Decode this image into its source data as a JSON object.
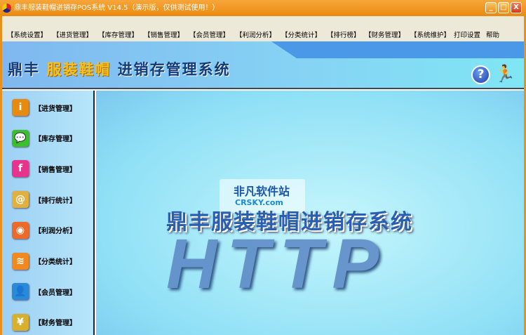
{
  "window": {
    "title": "鼎丰服装鞋帽进销存POS系统 V14.5（演示版，仅供测试使用！）",
    "minimize": "_",
    "maximize": "□",
    "close": "X"
  },
  "menu": [
    "【系统设置】",
    "【进货管理】",
    "【库存管理】",
    "【销售管理】",
    "【会员管理】",
    "【利润分析】",
    "【分类统计】",
    "【排行榜】",
    "【财务管理】",
    "【系统维护】",
    "打印设置",
    "帮助"
  ],
  "header": {
    "logo_prefix": "鼎丰 ",
    "logo_highlight": "服装鞋帽",
    "logo_suffix": " 进销存管理系统",
    "help_icon": "?",
    "exit_icon": "🏃"
  },
  "sidebar": [
    {
      "label": "【进货管理】",
      "icon": "i",
      "color": "#e88a10"
    },
    {
      "label": "【库存管理】",
      "icon": "💬",
      "color": "#3cbf2c"
    },
    {
      "label": "【销售管理】",
      "icon": "f",
      "color": "#e8338c"
    },
    {
      "label": "【排行统计】",
      "icon": "@",
      "color": "#e0b040"
    },
    {
      "label": "【利润分析】",
      "icon": "◉",
      "color": "#ee6a2a"
    },
    {
      "label": "【分类统计】",
      "icon": "≋",
      "color": "#f08a20"
    },
    {
      "label": "【会员管理】",
      "icon": "👤",
      "color": "#2a8ad8"
    },
    {
      "label": "【财务管理】",
      "icon": "¥",
      "color": "#d8b030"
    }
  ],
  "main": {
    "watermark_cn": "非凡软件站",
    "watermark_en": "CRSKY.com",
    "title": "鼎丰服装鞋帽进销存系统",
    "big_text": "HTTP"
  }
}
